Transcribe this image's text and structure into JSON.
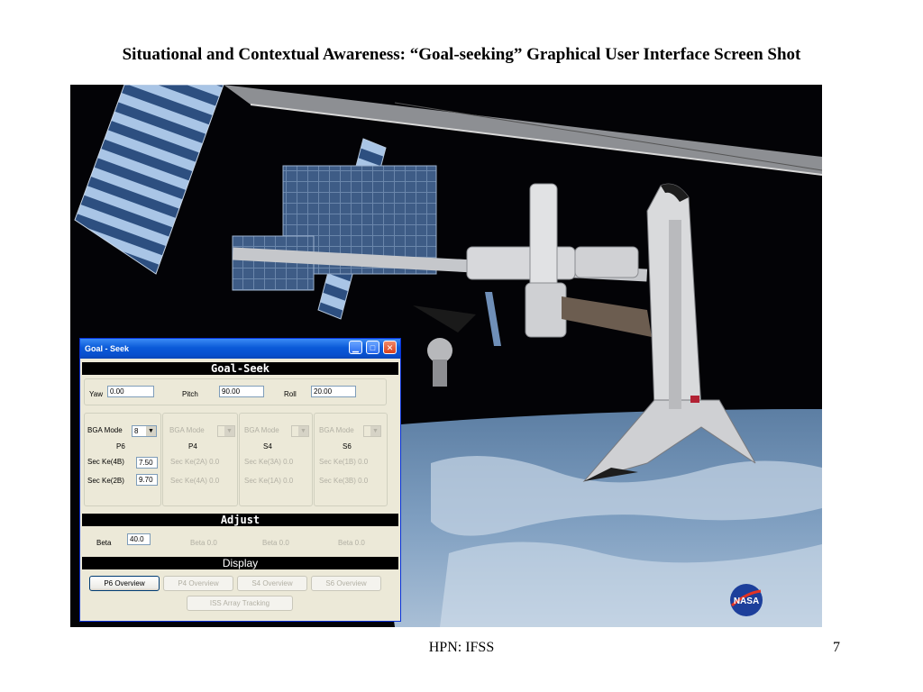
{
  "slide": {
    "title": "Situational and Contextual Awareness: “Goal-seeking” Graphical User Interface Screen Shot",
    "footer_center": "HPN: IFSS",
    "page_number": "7"
  },
  "window": {
    "title": "Goal - Seek",
    "controls": {
      "minimize": "▁",
      "maximize": "□",
      "close": "✕"
    },
    "sections": {
      "goal_seek": "Goal-Seek",
      "adjust": "Adjust",
      "display": "Display"
    },
    "attitude": {
      "yaw_label": "Yaw",
      "yaw_value": "0.00",
      "pitch_label": "Pitch",
      "pitch_value": "90.00",
      "roll_label": "Roll",
      "roll_value": "20.00"
    },
    "bga_groups": [
      {
        "mode_label": "BGA Mode",
        "mode_value": "8",
        "name": "P6",
        "sec1_label": "Sec Ke(4B)",
        "sec1_value": "7.50",
        "sec2_label": "Sec Ke(2B)",
        "sec2_value": "9.70"
      },
      {
        "mode_label": "BGA Mode",
        "mode_value": "",
        "name": "P4",
        "sec1_label": "Sec Ke(2A) 0.0",
        "sec2_label": "Sec Ke(4A) 0.0"
      },
      {
        "mode_label": "BGA Mode",
        "mode_value": "",
        "name": "S4",
        "sec1_label": "Sec Ke(3A) 0.0",
        "sec2_label": "Sec Ke(1A) 0.0"
      },
      {
        "mode_label": "BGA Mode",
        "mode_value": "",
        "name": "S6",
        "sec1_label": "Sec Ke(1B) 0.0",
        "sec2_label": "Sec Ke(3B) 0.0"
      }
    ],
    "adjust": {
      "beta_label": "Beta",
      "beta_value": "40.0",
      "beta2": "Beta 0.0",
      "beta3": "Beta 0.0",
      "beta4": "Beta 0.0"
    },
    "display_buttons": {
      "p6": "P6 Overview",
      "p4": "P4 Overview",
      "s4": "S4 Overview",
      "s6": "S6 Overview",
      "iss": "ISS Array Tracking"
    }
  },
  "colors": {
    "titlebar": "#0a5ad8",
    "window_bg": "#ece9d8",
    "section_bar": "#000000",
    "disabled_text": "#b2b0a4"
  },
  "icons": [
    "minimize-icon",
    "maximize-icon",
    "close-icon",
    "dropdown-arrow-icon",
    "nasa-logo"
  ],
  "logo_text": "NASA"
}
